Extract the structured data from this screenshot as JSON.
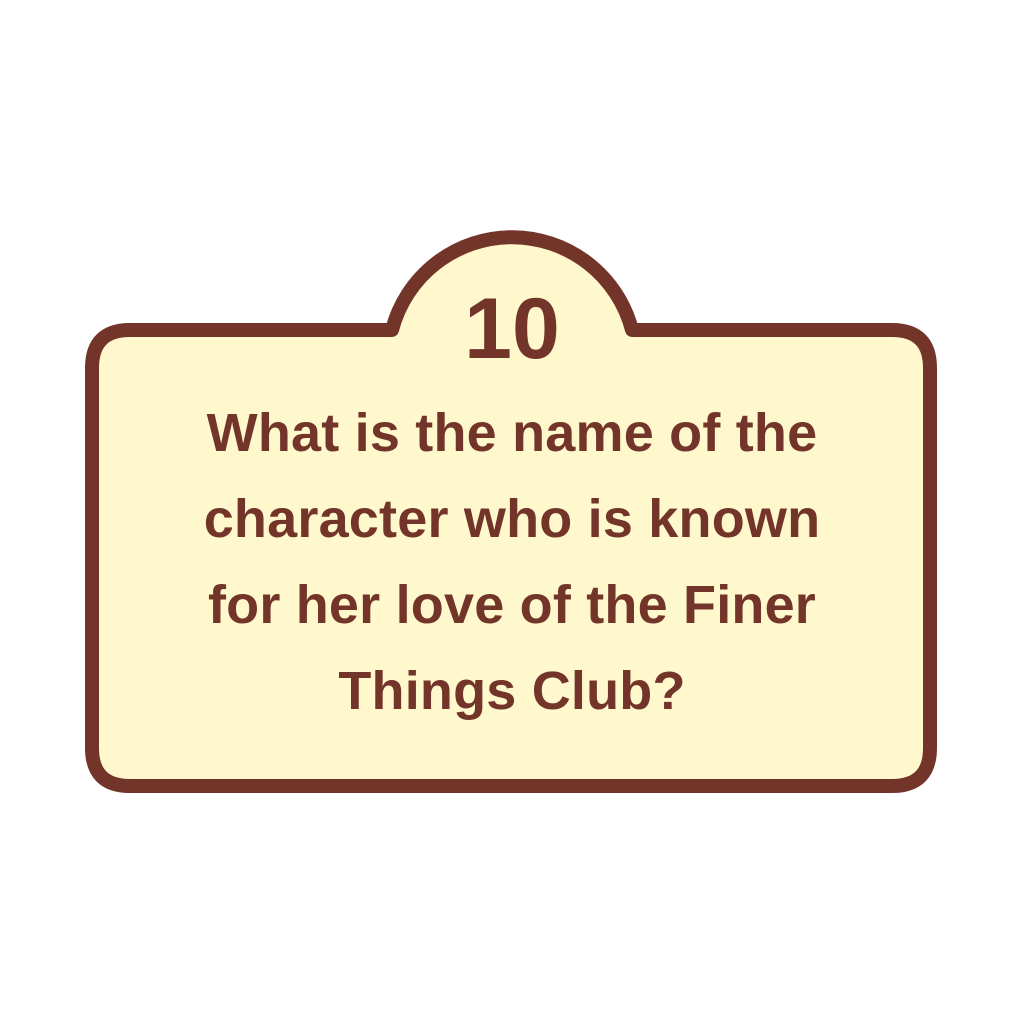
{
  "card": {
    "fill_color": "#fff8cd",
    "border_color": "#73352a"
  },
  "question": {
    "number": "10",
    "lines": [
      "What is the name of the",
      "character who is known",
      "for her love of the Finer",
      "Things Club?"
    ]
  }
}
